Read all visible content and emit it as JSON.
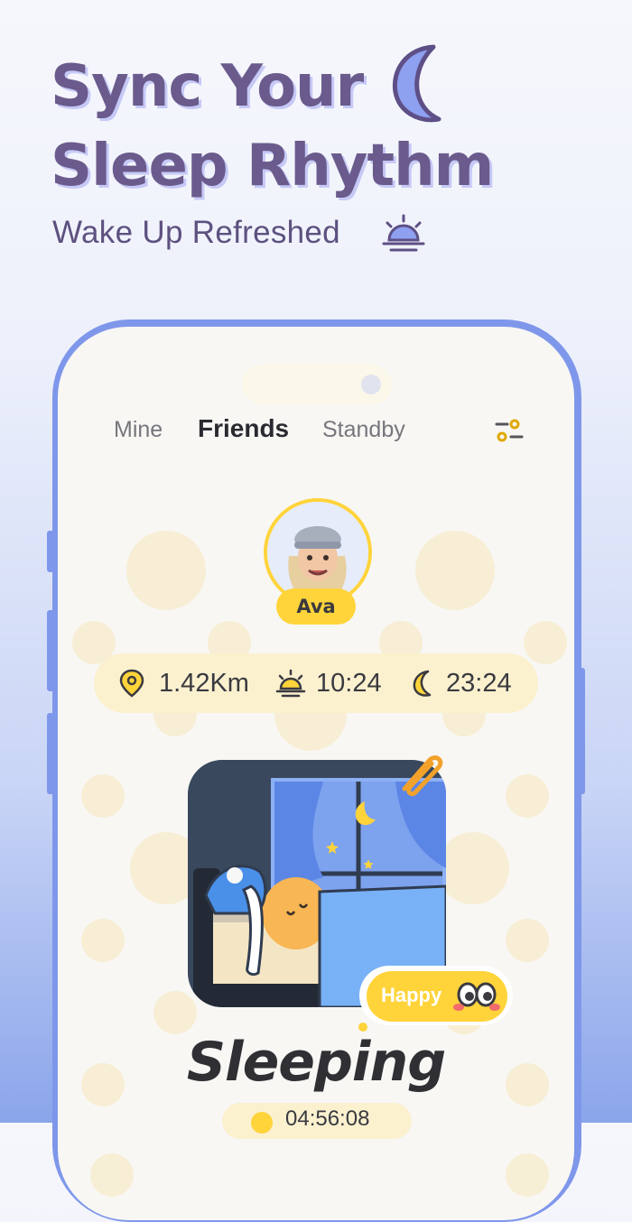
{
  "promo": {
    "headline_line1": "Sync Your",
    "headline_line2": "Sleep Rhythm",
    "subheadline": "Wake Up Refreshed"
  },
  "tabs": [
    {
      "label": "Mine",
      "active": false
    },
    {
      "label": "Friends",
      "active": true
    },
    {
      "label": "Standby",
      "active": false
    }
  ],
  "friend": {
    "name": "Ava",
    "distance": "1.42Km",
    "wake_time": "10:24",
    "sleep_time": "23:24",
    "status": "Sleeping",
    "mood": "Happy",
    "timer": "04:56:08"
  },
  "colors": {
    "accent_yellow": "#ffd43b",
    "phone_frame": "#7f97ea",
    "headline": "#6a5b8c"
  },
  "icons": [
    "moon-icon",
    "sunrise-icon",
    "filter-icon",
    "location-pin-icon",
    "alarm-sunrise-icon",
    "moon-small-icon",
    "paperclip-icon",
    "smiley-icon"
  ]
}
